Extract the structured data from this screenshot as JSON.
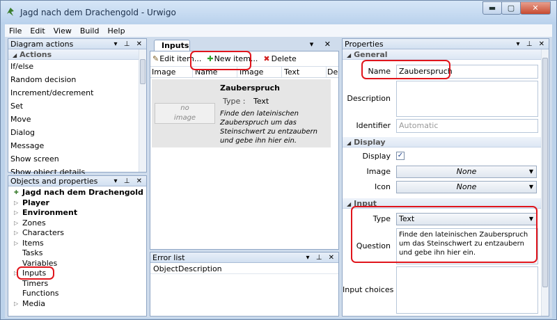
{
  "window": {
    "title": "Jagd nach dem Drachengold - Urwigo",
    "min": "▬",
    "max": "▢",
    "close": "✕"
  },
  "menu": [
    "File",
    "Edit",
    "View",
    "Build",
    "Help"
  ],
  "diagram_actions": {
    "title": "Diagram actions",
    "controls": "▾ ⊥ ✕",
    "section": "Actions",
    "items": [
      "If/else",
      "Random decision",
      "Increment/decrement",
      "Set",
      "Move",
      "Dialog",
      "Message",
      "Show screen",
      "Show object details"
    ]
  },
  "objects": {
    "title": "Objects and properties",
    "controls": "▾ ⊥ ✕",
    "nodes": [
      {
        "label": "Jagd nach dem Drachengold",
        "bold": true,
        "expander": "✚"
      },
      {
        "label": "Player",
        "bold": true,
        "expander": "▷"
      },
      {
        "label": "Environment",
        "bold": true,
        "expander": "▷"
      },
      {
        "label": "Zones",
        "bold": false,
        "expander": "▷"
      },
      {
        "label": "Characters",
        "bold": false,
        "expander": "▷"
      },
      {
        "label": "Items",
        "bold": false,
        "expander": "▷"
      },
      {
        "label": "Tasks",
        "bold": false,
        "expander": ""
      },
      {
        "label": "Variables",
        "bold": false,
        "expander": ""
      },
      {
        "label": "Inputs",
        "bold": false,
        "expander": "▷"
      },
      {
        "label": "Timers",
        "bold": false,
        "expander": ""
      },
      {
        "label": "Functions",
        "bold": false,
        "expander": ""
      },
      {
        "label": "Media",
        "bold": false,
        "expander": "▷"
      }
    ]
  },
  "inputs": {
    "tab": "Inputs",
    "controls": "▾ ✕",
    "toolbar": {
      "edit": "Edit item...",
      "new": "New item...",
      "delete": "Delete"
    },
    "columns": [
      "Image",
      "Name",
      "Image",
      "Text",
      "De"
    ],
    "entry": {
      "no_image": "no\nimage",
      "name": "Zauberspruch",
      "type_label": "Type :",
      "type_value": "Text",
      "text": "Finde den lateinischen Zauberspruch um das Steinschwert zu entzaubern und gebe ihn hier ein."
    }
  },
  "error_list": {
    "title": "Error list",
    "controls": "▾ ⊥ ✕",
    "columns": [
      "Object",
      "Description"
    ]
  },
  "properties": {
    "title": "Properties",
    "controls": "▾ ⊥ ✕",
    "sections": {
      "general": "General",
      "display": "Display",
      "input": "Input"
    },
    "name_label": "Name",
    "name_value": "Zauberspruch",
    "description_label": "Description",
    "identifier_label": "Identifier",
    "identifier_placeholder": "Automatic",
    "display_label": "Display",
    "display_check": "✓",
    "image_label": "Image",
    "image_value": "None",
    "icon_label": "Icon",
    "icon_value": "None",
    "type_label": "Type",
    "type_value": "Text",
    "question_label": "Question",
    "question_value": "Finde den lateinischen Zauberspruch um das Steinschwert zu entzaubern und gebe ihn hier ein.",
    "input_choices_label": "Input choices"
  },
  "colors": {
    "highlight": "#e0151c",
    "accent": "#bcd2ea"
  }
}
